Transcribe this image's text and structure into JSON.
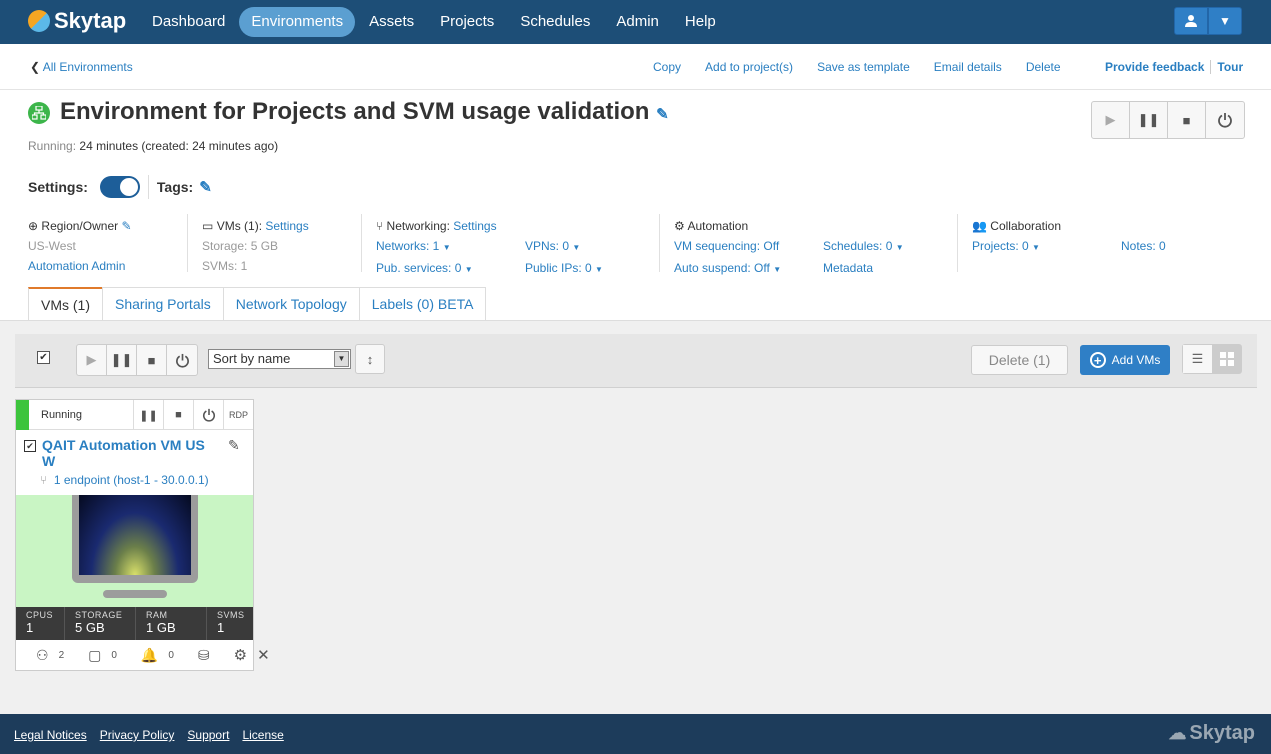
{
  "app": {
    "logo_text": "Skytap"
  },
  "nav": {
    "items": [
      {
        "label": "Dashboard",
        "active": false
      },
      {
        "label": "Environments",
        "active": true
      },
      {
        "label": "Assets",
        "active": false
      },
      {
        "label": "Projects",
        "active": false
      },
      {
        "label": "Schedules",
        "active": false
      },
      {
        "label": "Admin",
        "active": false
      },
      {
        "label": "Help",
        "active": false
      }
    ]
  },
  "actionbar": {
    "back_label": "All Environments",
    "actions": [
      "Copy",
      "Add to project(s)",
      "Save as template",
      "Email details",
      "Delete"
    ],
    "feedback": "Provide feedback",
    "tour": "Tour"
  },
  "env": {
    "title": "Environment for Projects and SVM usage validation",
    "running_label": "Running:",
    "running_text": "24 minutes (created: 24 minutes ago)",
    "settings_label": "Settings:",
    "tags_label": "Tags:",
    "settings_on": true
  },
  "info": {
    "region": {
      "heading": "Region/Owner",
      "region": "US-West",
      "owner": "Automation Admin"
    },
    "vms": {
      "heading": "VMs (1):",
      "settings": "Settings",
      "storage": "Storage: 5 GB",
      "svms": "SVMs: 1"
    },
    "networking": {
      "heading": "Networking:",
      "settings": "Settings",
      "networks": "Networks: 1",
      "vpns": "VPNs: 0",
      "pub_services": "Pub. services: 0",
      "public_ips": "Public IPs: 0"
    },
    "automation": {
      "heading": "Automation",
      "vm_sequencing": "VM sequencing: Off",
      "schedules": "Schedules: 0",
      "auto_suspend": "Auto suspend: Off",
      "metadata": "Metadata"
    },
    "collaboration": {
      "heading": "Collaboration",
      "projects": "Projects: 0",
      "notes": "Notes: 0"
    }
  },
  "tabs": [
    {
      "label": "VMs (1)",
      "active": true
    },
    {
      "label": "Sharing Portals",
      "active": false
    },
    {
      "label": "Network Topology",
      "active": false
    },
    {
      "label": "Labels (0) BETA",
      "active": false
    }
  ],
  "vm_toolbar": {
    "sort_value": "Sort by name",
    "delete_label": "Delete (1)",
    "add_label": "Add VMs"
  },
  "vm": {
    "status": "Running",
    "rdp": "RDP",
    "name": "QAIT Automation VM US W",
    "endpoint": "1 endpoint (host-1 - 30.0.0.1)",
    "specs": [
      {
        "key": "CPUS",
        "value": "1"
      },
      {
        "key": "STORAGE",
        "value": "5 GB"
      },
      {
        "key": "RAM",
        "value": "1 GB"
      },
      {
        "key": "SVMS",
        "value": "1"
      }
    ],
    "footer": {
      "users": "2",
      "comments": "0",
      "alerts": "0"
    }
  },
  "footer": {
    "links": [
      "Legal Notices",
      "Privacy Policy",
      "Support",
      "License"
    ],
    "logo_text": "Skytap"
  },
  "colors": {
    "topbar": "#1d4e77",
    "accent": "#2a7fc1",
    "running": "#3cc43c",
    "footer": "#1d3c5b"
  }
}
